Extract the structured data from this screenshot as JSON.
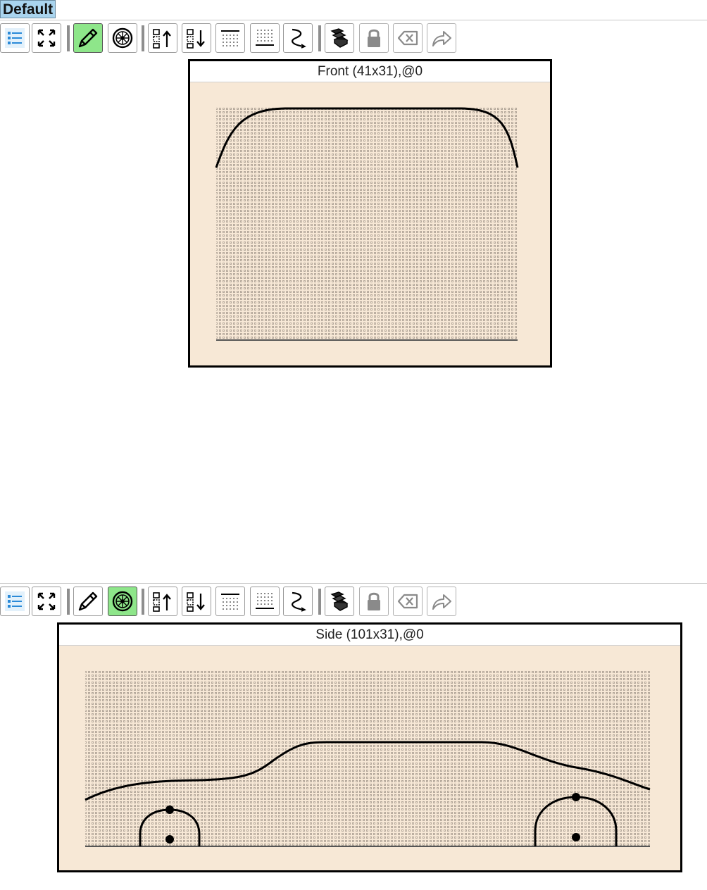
{
  "document_tab": {
    "label": "Default"
  },
  "toolbar_buttons": [
    {
      "name": "list-view-button",
      "icon": "list-icon",
      "state": "normal"
    },
    {
      "name": "fit-to-window-button",
      "icon": "expand-icon",
      "state": "normal"
    },
    {
      "name": "draw-mode-button",
      "icon": "pencil-icon",
      "state": "toggle"
    },
    {
      "name": "wheel-mode-button",
      "icon": "wheel-icon",
      "state": "toggle"
    },
    {
      "name": "move-up-button",
      "icon": "move-up-icon",
      "state": "normal"
    },
    {
      "name": "move-down-button",
      "icon": "move-down-icon",
      "state": "normal"
    },
    {
      "name": "grid-top-button",
      "icon": "grid-top-icon",
      "state": "normal"
    },
    {
      "name": "grid-bottom-button",
      "icon": "grid-bottom-icon",
      "state": "normal"
    },
    {
      "name": "curve-tool-button",
      "icon": "curve-icon",
      "state": "normal"
    },
    {
      "name": "layers-button",
      "icon": "layers-icon",
      "state": "normal"
    },
    {
      "name": "lock-button",
      "icon": "lock-icon",
      "state": "disabled"
    },
    {
      "name": "delete-button",
      "icon": "backspace-icon",
      "state": "disabled"
    },
    {
      "name": "share-button",
      "icon": "share-icon",
      "state": "disabled"
    }
  ],
  "views": [
    {
      "id": "front",
      "title": "Front (41x31),@0",
      "grid": {
        "cols": 41,
        "rows": 31
      },
      "active_mode": "draw-mode-button"
    },
    {
      "id": "side",
      "title": "Side (101x31),@0",
      "grid": {
        "cols": 101,
        "rows": 31
      },
      "active_mode": "wheel-mode-button"
    }
  ],
  "colors": {
    "canvas_bg": "#f7e8d6",
    "active_toggle": "#8ee68a",
    "tab_bg": "#a9d4ee",
    "stroke": "#000000"
  }
}
